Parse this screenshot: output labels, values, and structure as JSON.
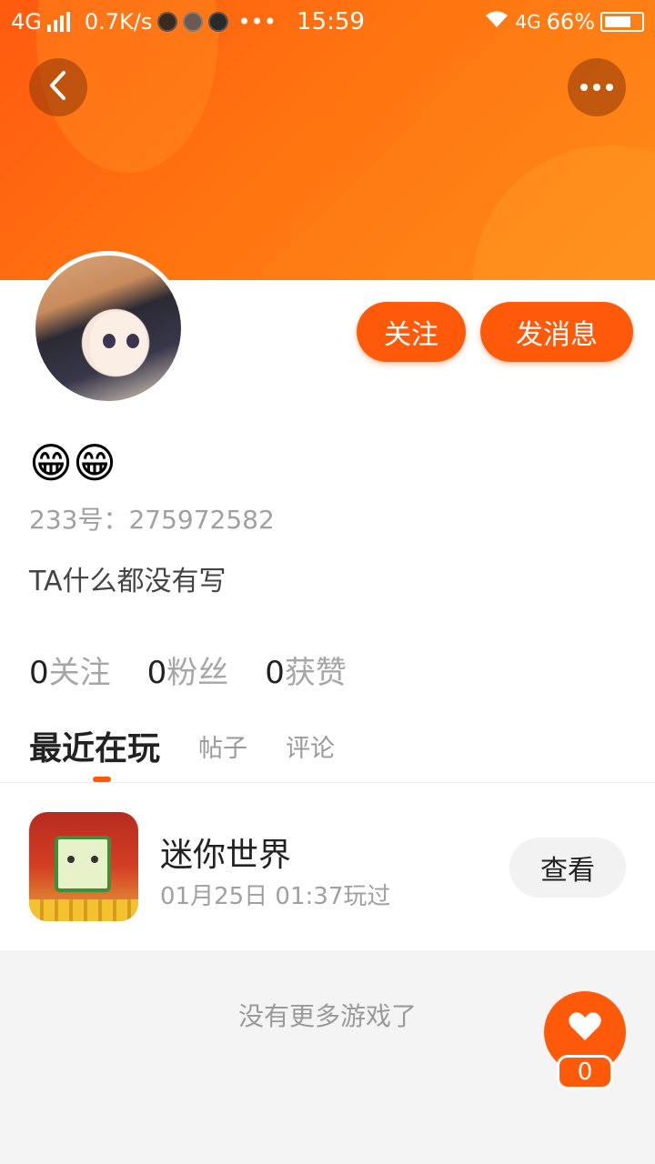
{
  "status_bar": {
    "network": "4G",
    "speed": "0.7K/s",
    "more": "•••",
    "time": "15:59",
    "network_right": "4G",
    "battery": "66%"
  },
  "icons": {
    "back": "chevron-left-icon",
    "more": "more-dots-icon",
    "like": "heart-icon"
  },
  "colors": {
    "accent": "#ff5a0a",
    "header_gradient": [
      "#ff5a0f",
      "#ff8c1a"
    ]
  },
  "profile": {
    "nickname": "😁😁",
    "user_id": "233号：275972582",
    "bio": "TA什么都没有写",
    "follow_label": "关注",
    "message_label": "发消息",
    "stats": [
      {
        "value": "0",
        "label": "关注"
      },
      {
        "value": "0",
        "label": "粉丝"
      },
      {
        "value": "0",
        "label": "获赞"
      }
    ]
  },
  "tabs": [
    {
      "label": "最近在玩",
      "active": true
    },
    {
      "label": "帖子",
      "active": false
    },
    {
      "label": "评论",
      "active": false
    }
  ],
  "games": [
    {
      "title": "迷你世界",
      "played": "01月25日 01:37玩过",
      "view_label": "查看"
    }
  ],
  "footer": {
    "no_more": "没有更多游戏了"
  },
  "like": {
    "count": "0"
  }
}
